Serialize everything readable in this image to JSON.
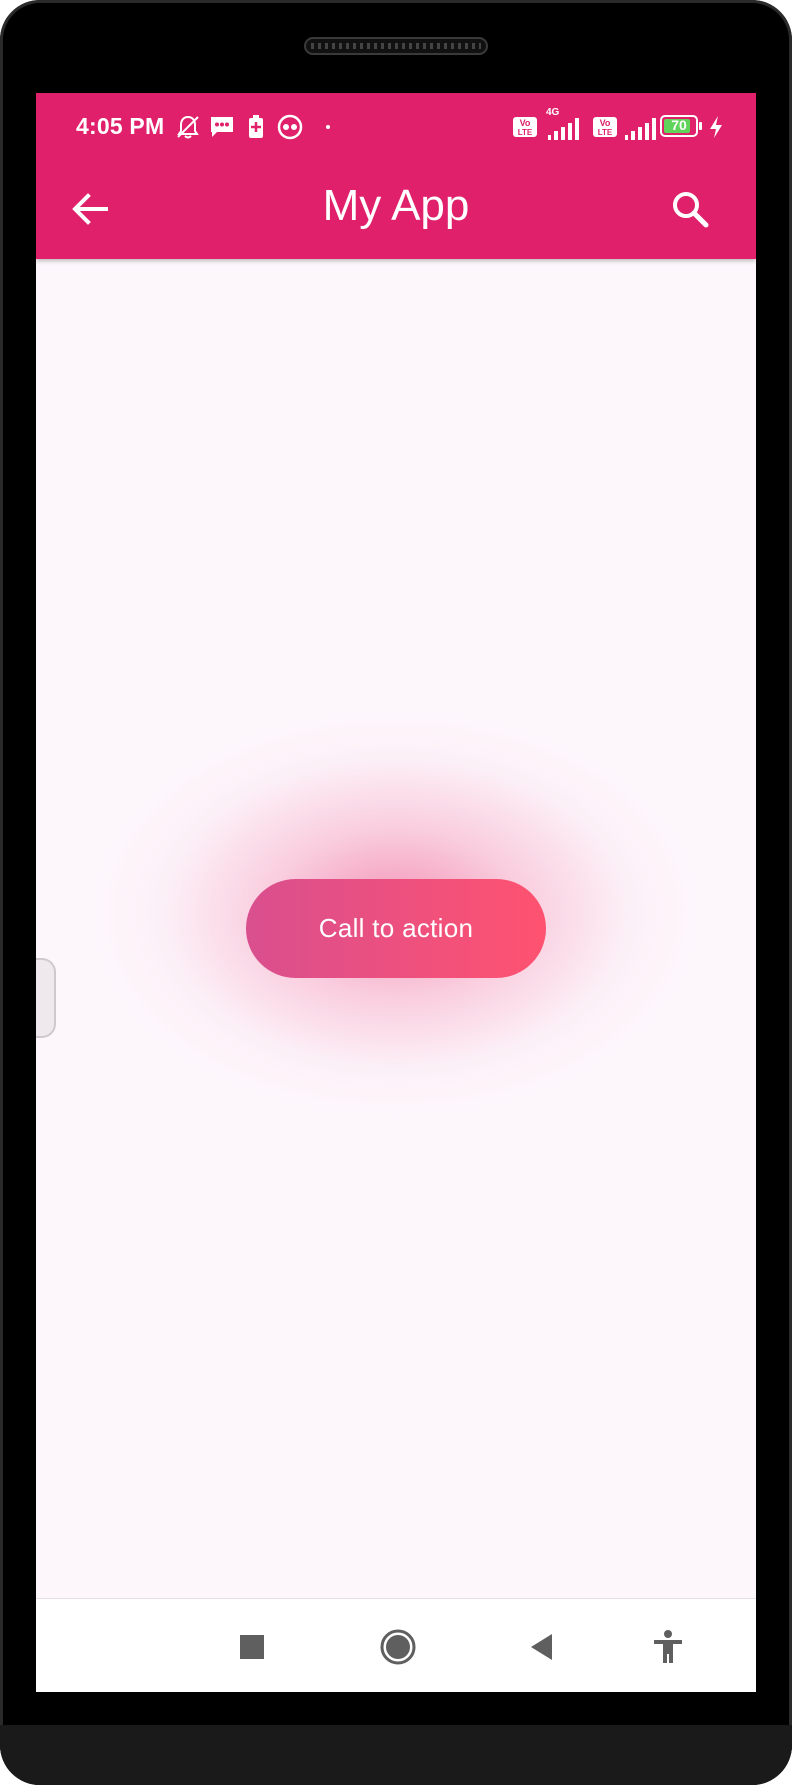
{
  "status_bar": {
    "time": "4:05 PM",
    "battery_level": "70",
    "network_label": "4G",
    "icons": [
      "bell-off-icon",
      "message-icon",
      "battery-saver-icon",
      "game-controller-icon",
      "dot-icon",
      "volte-icon",
      "signal-icon",
      "volte-icon",
      "signal-icon",
      "battery-icon",
      "charging-icon"
    ]
  },
  "app_bar": {
    "title": "My App",
    "back_icon": "arrow-back-icon",
    "search_icon": "search-icon",
    "color": "#e0206a"
  },
  "main": {
    "cta_label": "Call to action",
    "cta_gradient": [
      "#d94f8e",
      "#ff5270"
    ],
    "background": "#fdf7fc"
  },
  "nav_bar": {
    "buttons": [
      "recents-square-icon",
      "home-circle-icon",
      "back-triangle-icon",
      "accessibility-icon"
    ]
  }
}
